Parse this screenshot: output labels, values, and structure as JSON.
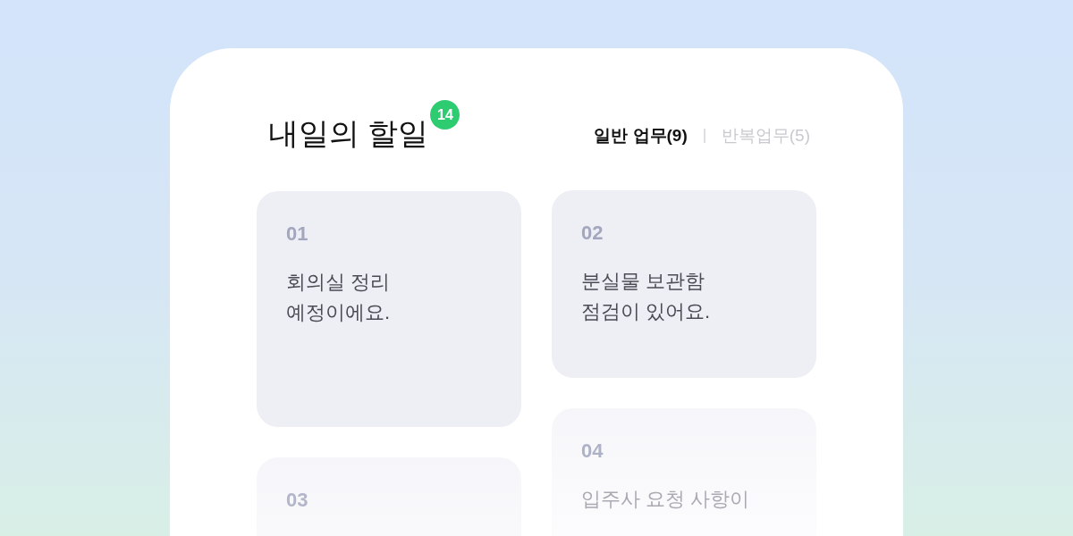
{
  "title": "내일의 할일",
  "badge": "14",
  "tabs": [
    {
      "label": "일반 업무(9)",
      "selected": true
    },
    {
      "label": "반복업무(5)",
      "selected": false
    }
  ],
  "columns": [
    [
      {
        "number": "01",
        "lines": [
          "회의실 정리",
          "예정이에요."
        ],
        "faded": false
      },
      {
        "number": "03",
        "faded": true
      }
    ],
    [
      {
        "number": "02",
        "lines": [
          "분실물 보관함",
          "점검이 있어요."
        ],
        "faded": false
      },
      {
        "number": "04",
        "lines": [
          "입주사 요청 사항이"
        ],
        "faded": true
      }
    ]
  ]
}
